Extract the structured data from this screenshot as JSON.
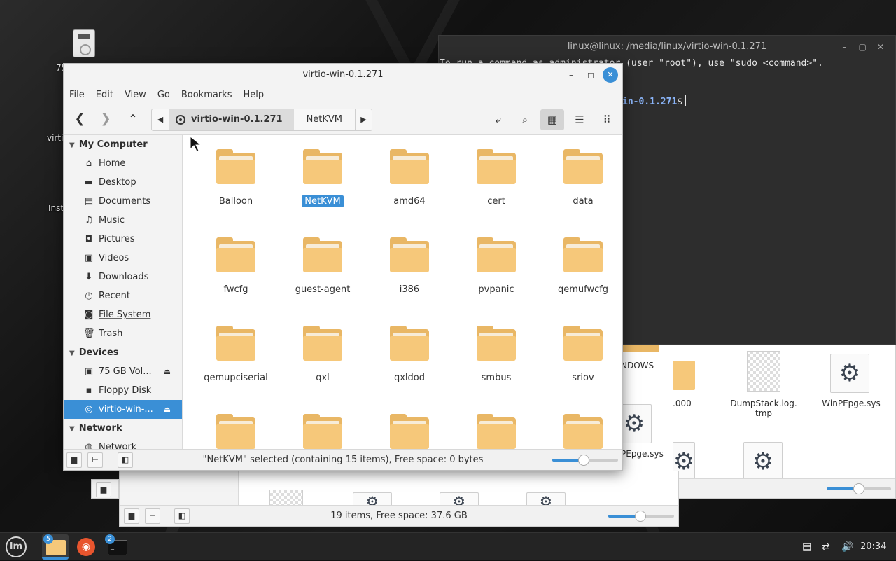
{
  "desktop": {
    "icon_label_1": "75",
    "icon_label_2": "virti",
    "icon_label_3": "Inst"
  },
  "terminal": {
    "title": "linux@linux: /media/linux/virtio-win-0.1.271",
    "line1": "To run a command as administrator (user \"root\"), use \"sudo <command>\".",
    "prompt": "in-0.1.271",
    "prompt_suffix": "$"
  },
  "back_window_1": {
    "items": [
      "NDOWS",
      ".000",
      "DumpStack.log.\ntmp",
      "WinPEpge.sys",
      "PEpge.sys"
    ]
  },
  "back_window_2": {
    "status": "19 items, Free space: 37.6 GB"
  },
  "file_manager": {
    "title": "virtio-win-0.1.271",
    "menu": [
      "File",
      "Edit",
      "View",
      "Go",
      "Bookmarks",
      "Help"
    ],
    "path": [
      "virtio-win-0.1.271",
      "NetKVM"
    ],
    "sidebar": {
      "my_computer": "My Computer",
      "places": [
        "Home",
        "Desktop",
        "Documents",
        "Music",
        "Pictures",
        "Videos",
        "Downloads",
        "Recent",
        "File System",
        "Trash"
      ],
      "devices": "Devices",
      "device_items": [
        "75 GB Vol...",
        "Floppy Disk",
        "virtio-win-..."
      ],
      "network": "Network",
      "network_items": [
        "Network"
      ]
    },
    "folders": [
      "Balloon",
      "NetKVM",
      "amd64",
      "cert",
      "data",
      "fwcfg",
      "guest-agent",
      "i386",
      "pvpanic",
      "qemufwcfg",
      "qemupciserial",
      "qxl",
      "qxldod",
      "smbus",
      "sriov"
    ],
    "selected_folder": "NetKVM",
    "status": "\"NetKVM\" selected (containing 15 items), Free space: 0 bytes",
    "zoom_level": 0.48
  },
  "taskbar": {
    "files_badge": "5",
    "terminal_badge": "2",
    "clock": "20:34"
  },
  "colors": {
    "accent": "#3a8fd6",
    "folder": "#f6c87a"
  }
}
